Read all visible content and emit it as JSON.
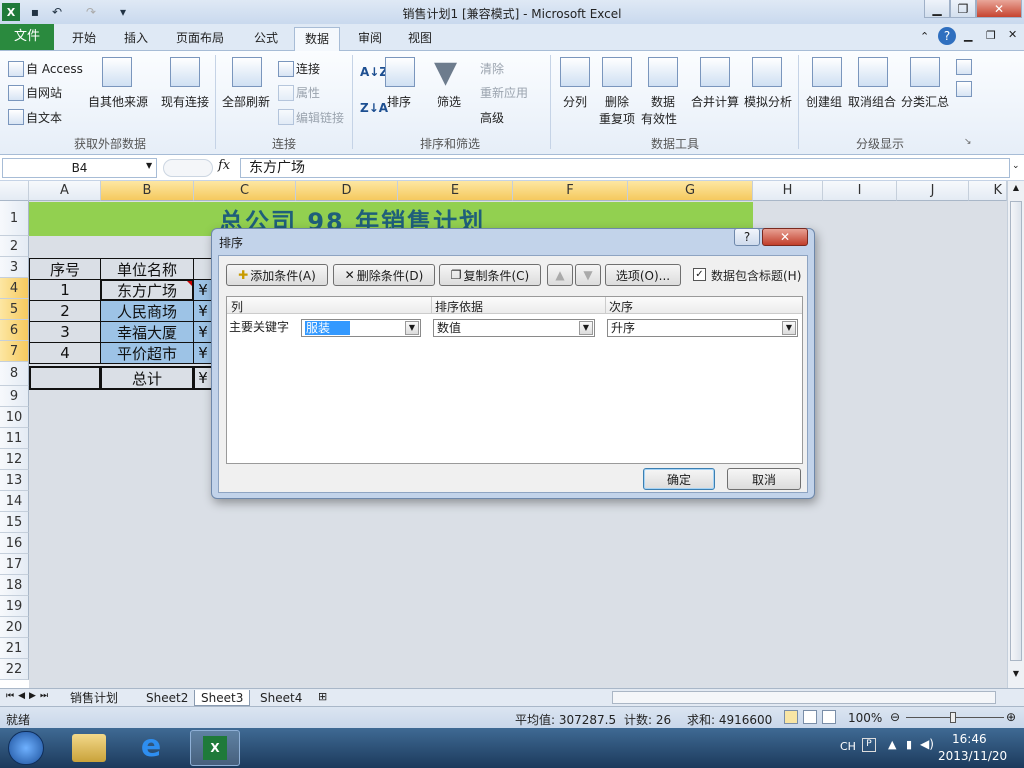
{
  "window": {
    "title": "销售计划1  [兼容模式] - Microsoft Excel"
  },
  "tabs": {
    "file": "文件",
    "home": "开始",
    "insert": "插入",
    "layout": "页面布局",
    "formulas": "公式",
    "data": "数据",
    "review": "审阅",
    "view": "视图"
  },
  "ribbon": {
    "get_external": {
      "access": "自 Access",
      "web": "自网站",
      "text": "自文本",
      "other": "自其他来源",
      "existing": "现有连接",
      "label": "获取外部数据"
    },
    "connections": {
      "refresh_all": "全部刷新",
      "connections": "连接",
      "properties": "属性",
      "edit_links": "编辑链接",
      "label": "连接"
    },
    "sort_filter": {
      "sort": "排序",
      "filter": "筛选",
      "clear": "清除",
      "reapply": "重新应用",
      "advanced": "高级",
      "label": "排序和筛选"
    },
    "data_tools": {
      "text_to_columns": "分列",
      "remove_dup_1": "删除",
      "remove_dup_2": "重复项",
      "validation_1": "数据",
      "validation_2": "有效性",
      "consolidate": "合并计算",
      "what_if": "模拟分析",
      "label": "数据工具"
    },
    "outline": {
      "group": "创建组",
      "ungroup": "取消组合",
      "subtotal": "分类汇总",
      "label": "分级显示"
    }
  },
  "formula_bar": {
    "name_box": "B4",
    "fx": "fx",
    "value": "东方广场"
  },
  "columns": [
    "A",
    "B",
    "C",
    "D",
    "E",
    "F",
    "G",
    "H",
    "I",
    "J",
    "K"
  ],
  "rows": [
    "1",
    "2",
    "3",
    "4",
    "5",
    "6",
    "7",
    "8",
    "9",
    "10",
    "11",
    "12",
    "13",
    "14",
    "15",
    "16",
    "17",
    "18",
    "19",
    "20",
    "21",
    "22"
  ],
  "sheet": {
    "banner": "总公司 98 年销售计划",
    "header_no": "序号",
    "header_unit": "单位名称",
    "r4": {
      "no": "1",
      "unit": "东方广场",
      "c": "¥"
    },
    "r5": {
      "no": "2",
      "unit": "人民商场",
      "c": "¥"
    },
    "r6": {
      "no": "3",
      "unit": "幸福大厦",
      "c": "¥"
    },
    "r7": {
      "no": "4",
      "unit": "平价超市",
      "c": "¥"
    },
    "r8": {
      "total": "总计",
      "c": "¥"
    }
  },
  "sheet_tabs": [
    "销售计划",
    "Sheet2",
    "Sheet3",
    "Sheet4"
  ],
  "status": {
    "ready": "就绪",
    "average": "平均值: 307287.5",
    "count": "计数: 26",
    "sum": "求和: 4916600",
    "zoom": "100%"
  },
  "taskbar": {
    "lang": "CH",
    "time": "16:46",
    "date": "2013/11/20"
  },
  "dialog": {
    "title": "排序",
    "help": "?",
    "close": "✕",
    "add": "添加条件(A)",
    "delete": "删除条件(D)",
    "copy": "复制条件(C)",
    "options": "选项(O)...",
    "has_header": "数据包含标题(H)",
    "has_header_checked": true,
    "col_header": "列",
    "sorton_header": "排序依据",
    "order_header": "次序",
    "row_label": "主要关键字",
    "key_value": "服装",
    "sorton_value": "数值",
    "order_value": "升序",
    "ok": "确定",
    "cancel": "取消"
  }
}
